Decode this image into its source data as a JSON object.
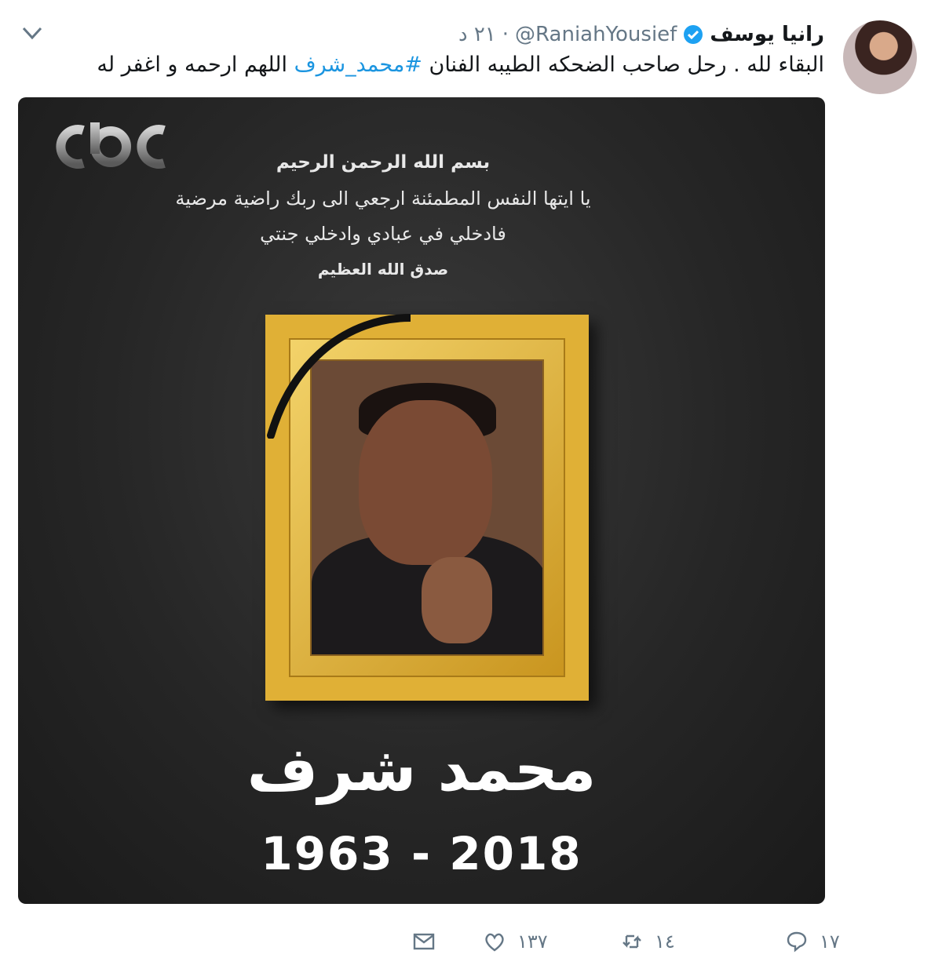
{
  "tweet": {
    "display_name": "رانيا يوسف",
    "handle": "@RaniahYousief",
    "separator": "·",
    "time": "٢١ د",
    "text_before": "البقاء لله . رحل صاحب الضحكه الطيبه الفنان ",
    "hashtag": "#محمد_شرف",
    "text_after": " اللهم ارحمه و اغفر له"
  },
  "media": {
    "verse_line1": "بسم الله الرحمن الرحيم",
    "verse_line2": "يا ايتها النفس المطمئنة ارجعي الى ربك راضية مرضية",
    "verse_line3": "فادخلي في عبادي وادخلي جنتي",
    "verse_line4": "صدق الله العظيم",
    "name": "محمد شرف",
    "years": "1963 - 2018"
  },
  "actions": {
    "reply_count": "١٧",
    "retweet_count": "١٤",
    "like_count": "١٣٧"
  },
  "colors": {
    "link": "#1b95e0",
    "secondary_text": "#657786",
    "verified": "#1da1f2",
    "frame_gold": "#e0b036"
  }
}
